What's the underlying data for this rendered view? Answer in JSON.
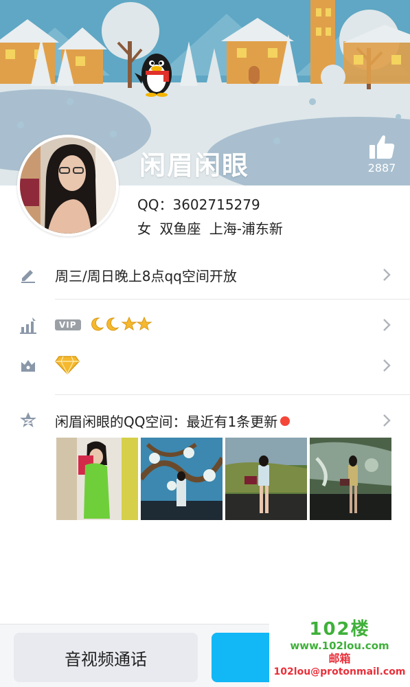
{
  "profile": {
    "nickname": "闲眉闲眼",
    "like_count": "2887",
    "qq_label": "QQ：3602715279",
    "meta": "女  双鱼座  上海-浦东新"
  },
  "rows": {
    "signature": "周三/周日晚上8点qq空间开放",
    "vip_badge": "VIP",
    "qzone": "闲眉闲眼的QQ空间：最近有1条更新"
  },
  "actions": {
    "call_label": "音视频通话",
    "send_label": ""
  },
  "watermark": {
    "logo": "102楼",
    "site": "www.102lou.com",
    "mail_label": "邮箱",
    "email": "102lou@protonmail.com"
  },
  "colors": {
    "accent": "#12b7f5",
    "banner_sky": "#5fa7c4",
    "red_dot": "#f4473a",
    "watermark_green": "#3fb03a",
    "watermark_red": "#e8303a"
  }
}
